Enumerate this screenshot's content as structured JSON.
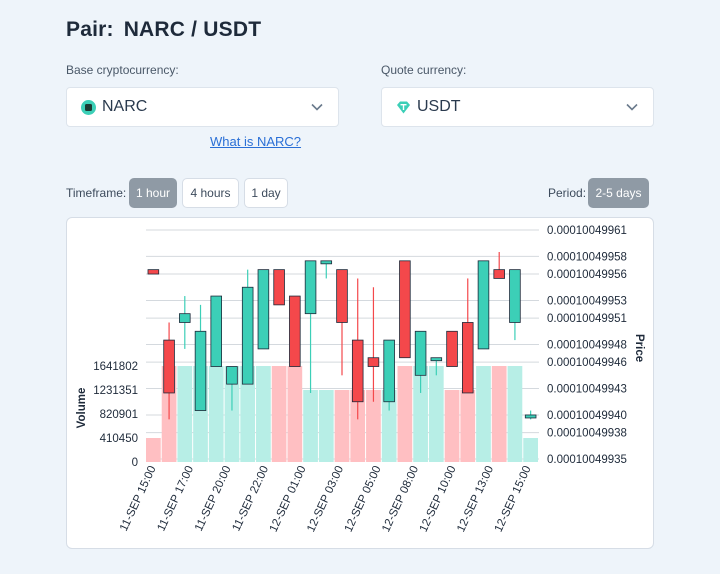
{
  "header": {
    "pair_label": "Pair:",
    "pair_value": "NARC / USDT"
  },
  "base": {
    "label": "Base cryptocurrency:",
    "value": "NARC",
    "icon": "narc-coin-icon"
  },
  "quote": {
    "label": "Quote currency:",
    "value": "USDT",
    "icon": "tether-icon"
  },
  "link": {
    "what_is": "What is NARC?"
  },
  "timeframe": {
    "label": "Timeframe:",
    "options": [
      "1 hour",
      "4 hours",
      "1 day"
    ],
    "selected": "1 hour"
  },
  "period": {
    "label": "Period:",
    "value": "2-5 days"
  },
  "colors": {
    "up": "#3ccfb7",
    "down": "#f4484b",
    "up_vol": "#b7eee6",
    "down_vol": "#ffbfc2",
    "accent_link": "#2a6fd6",
    "active_btn": "#8f9aa5"
  },
  "chart_data": {
    "type": "candlestick",
    "price_axis_label": "Price",
    "volume_axis_label": "Volume",
    "price_ticks": [
      "0.00010049961",
      "0.00010049958",
      "0.00010049956",
      "0.00010049953",
      "0.00010049951",
      "0.00010049948",
      "0.00010049946",
      "0.00010049943",
      "0.00010049940",
      "0.00010049938",
      "0.00010049935"
    ],
    "volume_ticks": [
      "1641802",
      "1231351",
      "820901",
      "410450",
      "0"
    ],
    "x_labels": [
      "11-SEP 15:00",
      "11-SEP 17:00",
      "11-SEP 20:00",
      "11-SEP 22:00",
      "12-SEP 01:00",
      "12-SEP 03:00",
      "12-SEP 05:00",
      "12-SEP 08:00",
      "12-SEP 10:00",
      "12-SEP 13:00",
      "12-SEP 15:00"
    ],
    "candles": [
      {
        "o": 0.000100499565,
        "c": 0.00010049956,
        "h": 0.000100499565,
        "l": 0.00010049956,
        "v": 410450
      },
      {
        "o": 0.000100499485,
        "c": 0.000100499425,
        "h": 0.000100499505,
        "l": 0.000100499395,
        "v": 1641802
      },
      {
        "o": 0.000100499505,
        "c": 0.000100499515,
        "h": 0.000100499535,
        "l": 0.000100499475,
        "v": 1641802
      },
      {
        "o": 0.000100499405,
        "c": 0.000100499495,
        "h": 0.000100499525,
        "l": 0.000100499405,
        "v": 1641802
      },
      {
        "o": 0.000100499455,
        "c": 0.000100499535,
        "h": 0.000100499535,
        "l": 0.000100499455,
        "v": 1641802
      },
      {
        "o": 0.000100499435,
        "c": 0.000100499455,
        "h": 0.000100499455,
        "l": 0.000100499405,
        "v": 1641802
      },
      {
        "o": 0.000100499435,
        "c": 0.000100499545,
        "h": 0.000100499565,
        "l": 0.000100499435,
        "v": 1641802
      },
      {
        "o": 0.000100499475,
        "c": 0.000100499565,
        "h": 0.000100499565,
        "l": 0.000100499475,
        "v": 1641802
      },
      {
        "o": 0.000100499565,
        "c": 0.000100499525,
        "h": 0.000100499565,
        "l": 0.000100499525,
        "v": 1641802
      },
      {
        "o": 0.000100499535,
        "c": 0.000100499455,
        "h": 0.000100499535,
        "l": 0.000100499455,
        "v": 1641802
      },
      {
        "o": 0.000100499515,
        "c": 0.000100499575,
        "h": 0.000100499575,
        "l": 0.000100499425,
        "v": 1231351
      },
      {
        "o": 0.000100499575,
        "c": 0.000100499575,
        "h": 0.000100499575,
        "l": 0.000100499555,
        "v": 1231351
      },
      {
        "o": 0.000100499565,
        "c": 0.000100499505,
        "h": 0.000100499565,
        "l": 0.000100499445,
        "v": 1231351
      },
      {
        "o": 0.000100499485,
        "c": 0.000100499415,
        "h": 0.000100499555,
        "l": 0.000100499395,
        "v": 1231351
      },
      {
        "o": 0.000100499465,
        "c": 0.000100499455,
        "h": 0.000100499545,
        "l": 0.000100499415,
        "v": 1231351
      },
      {
        "o": 0.000100499415,
        "c": 0.000100499485,
        "h": 0.000100499485,
        "l": 0.000100499405,
        "v": 1231351
      },
      {
        "o": 0.000100499575,
        "c": 0.000100499465,
        "h": 0.000100499575,
        "l": 0.000100499465,
        "v": 1641802
      },
      {
        "o": 0.000100499445,
        "c": 0.000100499495,
        "h": 0.000100499495,
        "l": 0.000100499425,
        "v": 1641802
      },
      {
        "o": 0.000100499465,
        "c": 0.000100499465,
        "h": 0.000100499465,
        "l": 0.000100499445,
        "v": 1641802
      },
      {
        "o": 0.000100499495,
        "c": 0.000100499455,
        "h": 0.000100499495,
        "l": 0.000100499455,
        "v": 1231351
      },
      {
        "o": 0.000100499505,
        "c": 0.000100499425,
        "h": 0.000100499555,
        "l": 0.000100499425,
        "v": 1231351
      },
      {
        "o": 0.000100499475,
        "c": 0.000100499575,
        "h": 0.000100499575,
        "l": 0.000100499475,
        "v": 1641802
      },
      {
        "o": 0.000100499565,
        "c": 0.000100499555,
        "h": 0.000100499585,
        "l": 0.000100499555,
        "v": 1641802
      },
      {
        "o": 0.000100499505,
        "c": 0.000100499565,
        "h": 0.000100499565,
        "l": 0.000100499485,
        "v": 1641802
      },
      {
        "o": 0.0001004994,
        "c": 0.0001004994,
        "h": 0.000100499405,
        "l": 0.000100499395,
        "v": 410450
      }
    ]
  }
}
